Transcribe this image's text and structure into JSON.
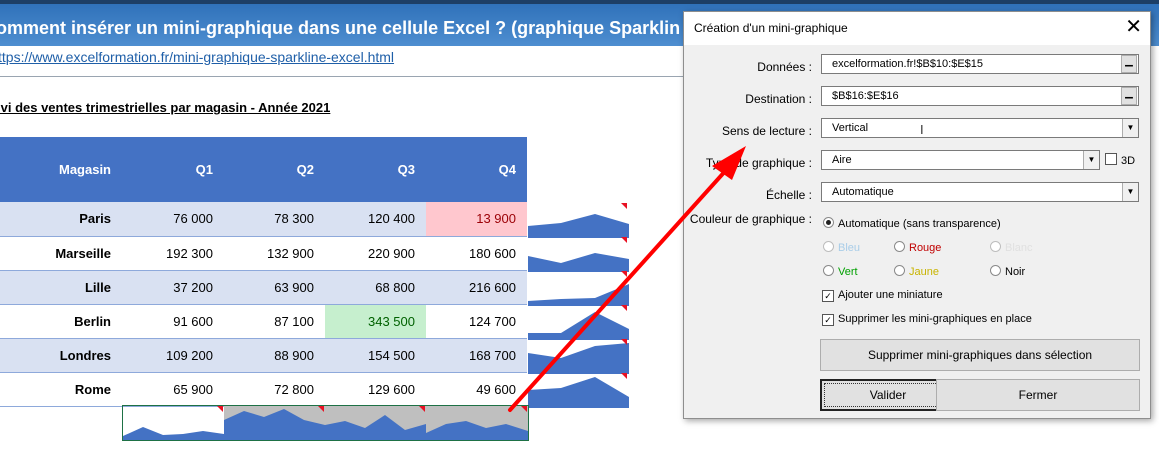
{
  "page": {
    "title": "omment insérer un mini-graphique dans une cellule Excel ? (graphique Sparklin",
    "url": "ttps://www.excelformation.fr/mini-graphique-sparkline-excel.html",
    "subtitle": "ivi des ventes trimestrielles par magasin - Année 2021"
  },
  "table": {
    "headers": [
      "Magasin",
      "Q1",
      "Q2",
      "Q3",
      "Q4"
    ],
    "rows": [
      {
        "store": "Paris",
        "q1": "76 000",
        "q2": "78 300",
        "q3": "120 400",
        "q4": "13 900"
      },
      {
        "store": "Marseille",
        "q1": "192 300",
        "q2": "132 900",
        "q3": "220 900",
        "q4": "180 600"
      },
      {
        "store": "Lille",
        "q1": "37 200",
        "q2": "63 900",
        "q3": "68 800",
        "q4": "216 600"
      },
      {
        "store": "Berlin",
        "q1": "91 600",
        "q2": "87 100",
        "q3": "343 500",
        "q4": "124 700"
      },
      {
        "store": "Londres",
        "q1": "109 200",
        "q2": "88 900",
        "q3": "154 500",
        "q4": "168 700"
      },
      {
        "store": "Rome",
        "q1": "65 900",
        "q2": "72 800",
        "q3": "129 600",
        "q4": "49 600"
      }
    ],
    "highlight_low_color": "#ffc7ce",
    "highlight_high_color": "#c6efce",
    "header_color": "#4472c4",
    "sparkline_color": "#4472c4"
  },
  "dialog": {
    "title": "Création d'un mini-graphique",
    "close_icon": "close-icon",
    "donnees_label": "Données :",
    "donnees_value": "excelformation.fr!$B$10:$E$15",
    "destination_label": "Destination :",
    "destination_value": "$B$16:$E$16",
    "sens_label": "Sens de lecture :",
    "sens_value": "Vertical",
    "type_label": "Type de graphique :",
    "type_value": "Aire",
    "checkbox_3d": "3D",
    "echelle_label": "Échelle :",
    "echelle_value": "Automatique",
    "couleur_label": "Couleur de graphique :",
    "color_options": {
      "auto": "Automatique (sans transparence)",
      "bleu": "Bleu",
      "rouge": "Rouge",
      "blanc": "Blanc",
      "vert": "Vert",
      "jaune": "Jaune",
      "noir": "Noir"
    },
    "ajouter_miniature": "Ajouter une miniature",
    "supprimer_place": "Supprimer les mini-graphiques en place",
    "supprimer_button": "Supprimer mini-graphiques dans sélection",
    "valider_button": "Valider",
    "fermer_button": "Fermer"
  }
}
